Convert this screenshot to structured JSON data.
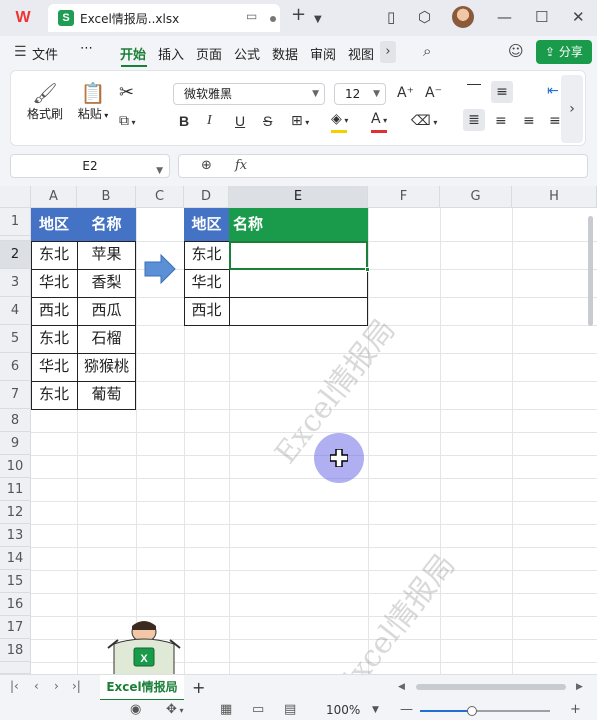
{
  "titlebar": {
    "app_logo": "W",
    "tab_icon": "S",
    "tab_title": "Excel情报局..xlsx",
    "icons": [
      "monitor-icon",
      "dot-icon",
      "plus-icon",
      "chevron-down-icon",
      "book-icon",
      "cube-icon",
      "avatar",
      "minimize-icon",
      "maximize-icon",
      "close-icon"
    ]
  },
  "menu": {
    "file": "文件",
    "more": "⋯",
    "items": [
      "开始",
      "插入",
      "页面",
      "公式",
      "数据",
      "审阅",
      "视图"
    ],
    "active": "开始",
    "share": "分享"
  },
  "ribbon": {
    "format_painter": "格式刷",
    "paste": "粘贴",
    "font_name": "微软雅黑",
    "font_size": "12",
    "bold": "B",
    "italic": "I",
    "underline": "U",
    "strike": "S",
    "font_color_accent": "#e03030",
    "fill_color_accent": "#f5d000"
  },
  "formula_bar": {
    "name_box": "E2",
    "fx": "fx",
    "formula": ""
  },
  "grid": {
    "columns": [
      "A",
      "B",
      "C",
      "D",
      "E",
      "F",
      "G",
      "H"
    ],
    "selected_column": "E",
    "rows": [
      "1",
      "2",
      "3",
      "4",
      "5",
      "6",
      "7",
      "8",
      "9",
      "10",
      "11",
      "12",
      "13",
      "14",
      "15",
      "16",
      "17",
      "18"
    ],
    "selected_row": "2",
    "table1": {
      "headers": [
        "地区",
        "名称"
      ],
      "rows": [
        [
          "东北",
          "苹果"
        ],
        [
          "华北",
          "香梨"
        ],
        [
          "西北",
          "西瓜"
        ],
        [
          "东北",
          "石榴"
        ],
        [
          "华北",
          "猕猴桃"
        ],
        [
          "东北",
          "葡萄"
        ]
      ]
    },
    "table2": {
      "headers": [
        "地区",
        "名称"
      ],
      "rows": [
        [
          "东北",
          ""
        ],
        [
          "华北",
          ""
        ],
        [
          "西北",
          ""
        ]
      ]
    },
    "watermark": "Excel情报局",
    "header_blue": "#4472c4",
    "header_green": "#1a9b4b"
  },
  "sheets": {
    "active": "Excel情报局",
    "add": "+"
  },
  "statusbar": {
    "zoom": "100%",
    "zoom_fraction": 0.4
  }
}
